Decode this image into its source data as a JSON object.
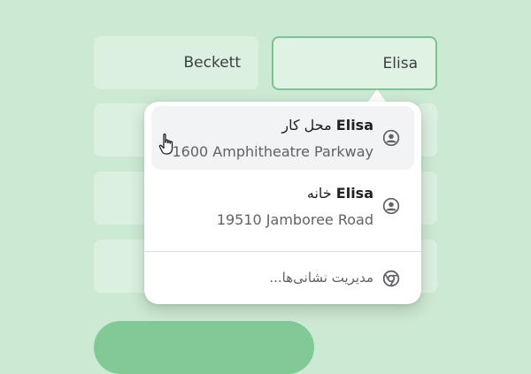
{
  "form": {
    "last_name_value": "Beckett",
    "first_name_value": "Elisa"
  },
  "autofill": {
    "suggestions": [
      {
        "name": "Elisa",
        "label": "محل کار",
        "address": "1600 Amphitheatre Parkway",
        "icon": "person-icon"
      },
      {
        "name": "Elisa",
        "label": "خانه",
        "address": "19510 Jamboree Road",
        "icon": "person-icon"
      }
    ],
    "manage_label": "مدیریت نشانی‌ها...",
    "manage_icon": "chrome-icon"
  },
  "colors": {
    "background": "#cce9d3",
    "field": "#dcf0e0",
    "focus_border": "#7ec38f",
    "button": "#81c995",
    "highlight": "#f1f3f4"
  }
}
